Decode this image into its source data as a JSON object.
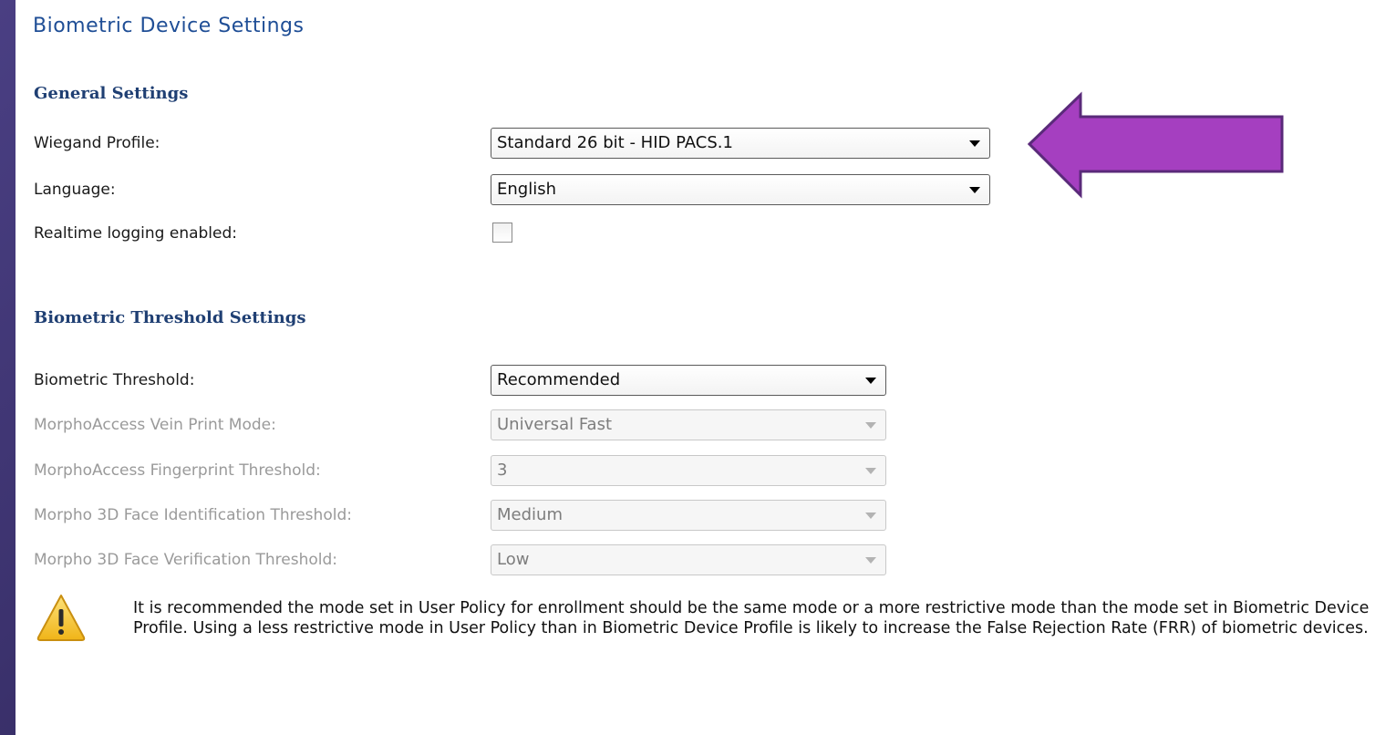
{
  "page": {
    "title": "Biometric Device Settings"
  },
  "general": {
    "heading": "General Settings",
    "wiegand_label": "Wiegand Profile:",
    "wiegand_value": "Standard 26 bit - HID PACS.1",
    "language_label": "Language:",
    "language_value": "English",
    "realtime_label": "Realtime logging enabled:",
    "realtime_checked": false
  },
  "threshold": {
    "heading": "Biometric Threshold Settings",
    "biometric_label": "Biometric Threshold:",
    "biometric_value": "Recommended",
    "vein_label": "MorphoAccess Vein Print Mode:",
    "vein_value": "Universal Fast",
    "fingerprint_label": "MorphoAccess Fingerprint Threshold:",
    "fingerprint_value": "3",
    "face_id_label": "Morpho 3D Face Identification Threshold:",
    "face_id_value": "Medium",
    "face_verif_label": "Morpho 3D Face Verification Threshold:",
    "face_verif_value": "Low"
  },
  "warning": {
    "icon": "warning-icon",
    "text": "It is recommended the mode set in User Policy for enrollment should be the same mode or a more restrictive mode than the mode set in Biometric Device Profile.  Using a less restrictive mode in User Policy than in Biometric Device Profile is likely to increase the False Rejection Rate (FRR) of biometric devices."
  },
  "colors": {
    "background": "#3a2f6b",
    "title": "#1f4e96",
    "heading": "#1f3f73",
    "arrow_fill": "#a53fc0",
    "arrow_stroke": "#5a2a7a",
    "warning_fill": "#f7c325"
  }
}
